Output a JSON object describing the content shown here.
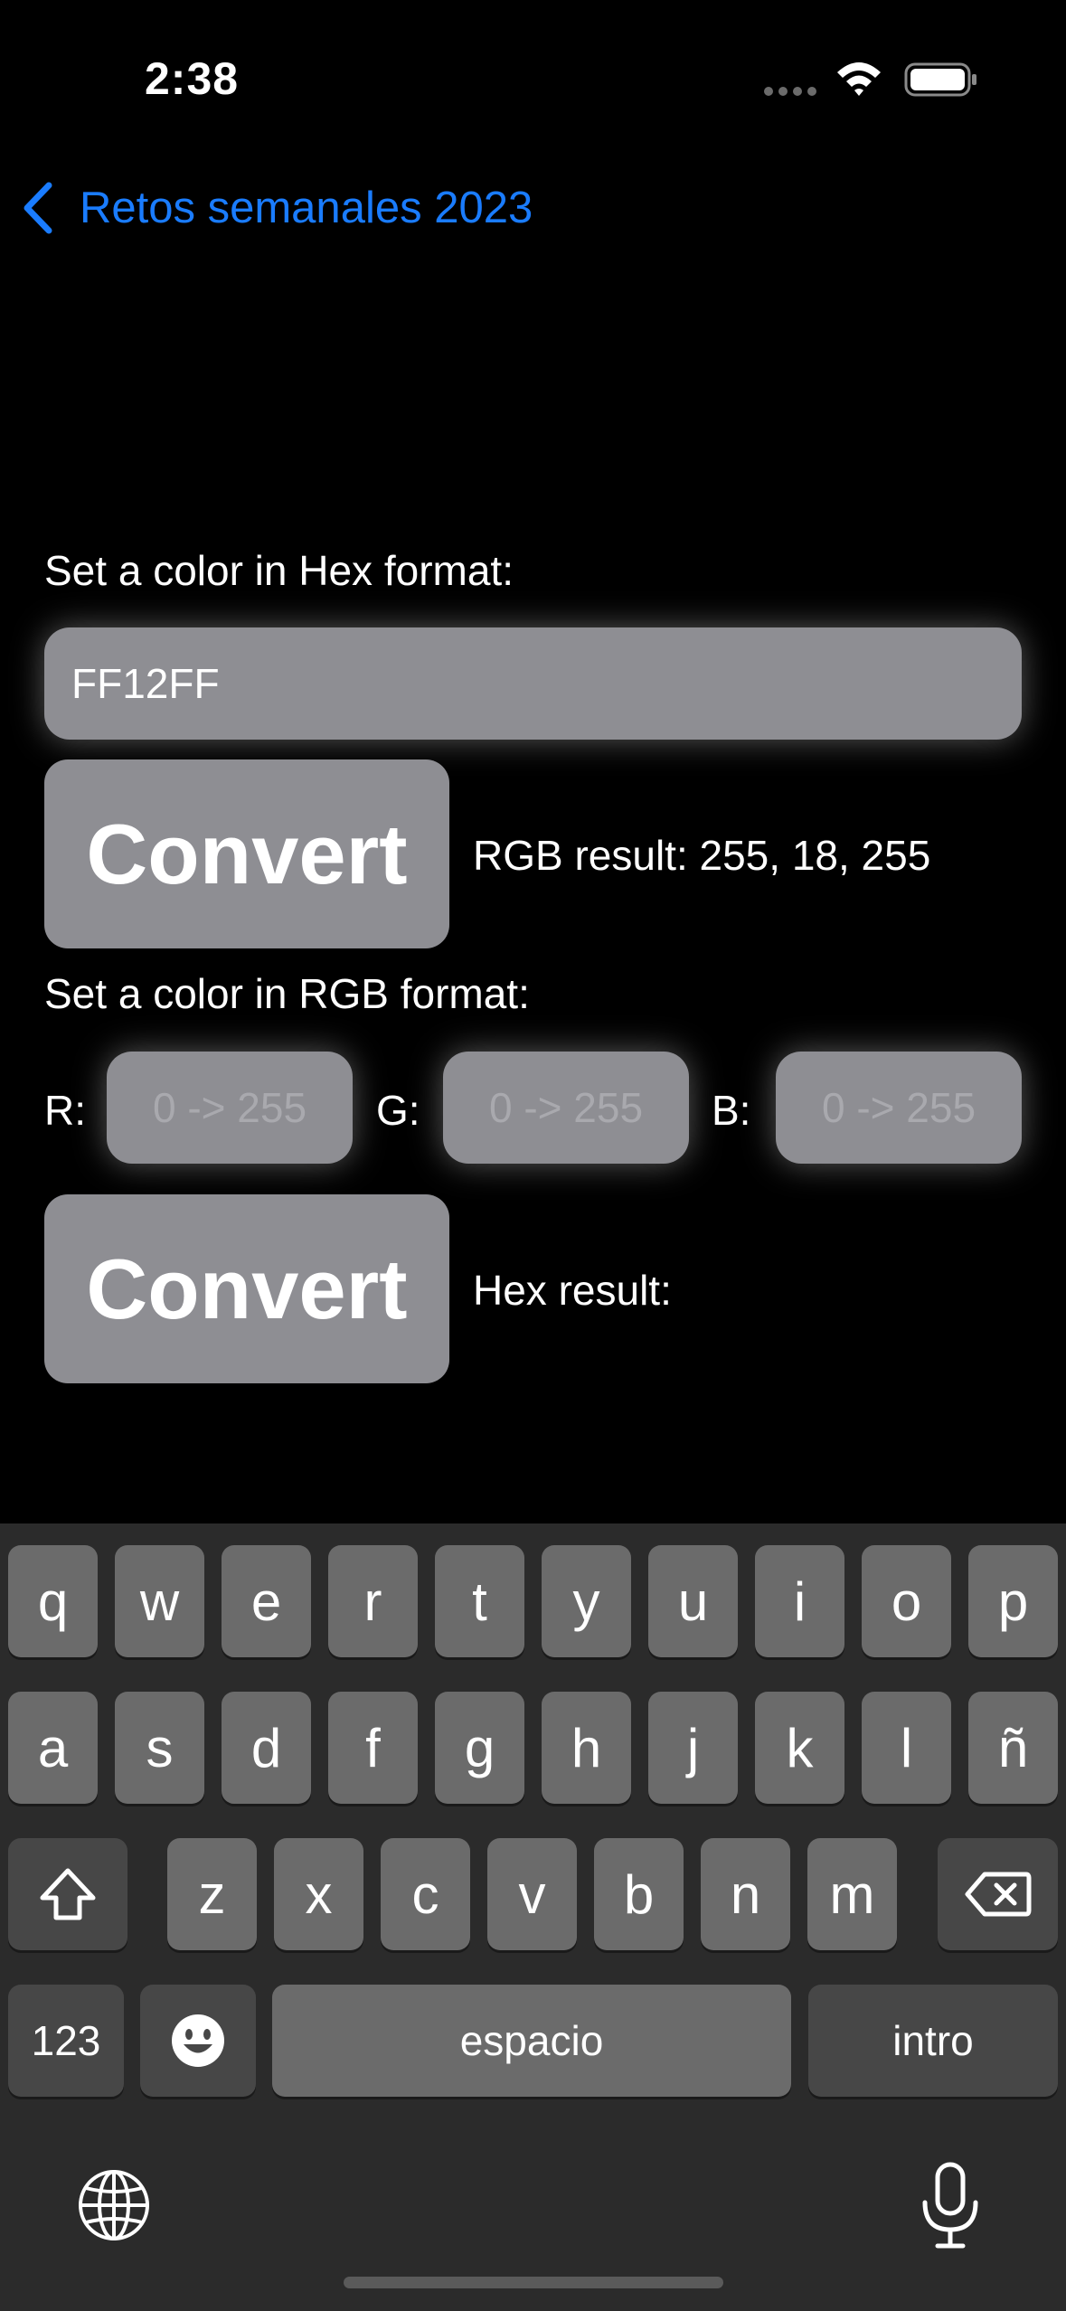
{
  "status_bar": {
    "time": "2:38"
  },
  "nav": {
    "back_label": "Retos semanales 2023"
  },
  "hex_section": {
    "label": "Set a color in Hex format:",
    "input_value": "FF12FF",
    "convert_label": "Convert",
    "result_text": "RGB result: 255, 18, 255"
  },
  "rgb_section": {
    "label": "Set a color in RGB format:",
    "r_label": "R:",
    "g_label": "G:",
    "b_label": "B:",
    "placeholder": "0 -> 255",
    "convert_label": "Convert",
    "result_text": "Hex result:"
  },
  "keyboard": {
    "row1": [
      "q",
      "w",
      "e",
      "r",
      "t",
      "y",
      "u",
      "i",
      "o",
      "p"
    ],
    "row2": [
      "a",
      "s",
      "d",
      "f",
      "g",
      "h",
      "j",
      "k",
      "l",
      "ñ"
    ],
    "row3": [
      "z",
      "x",
      "c",
      "v",
      "b",
      "n",
      "m"
    ],
    "numbers_label": "123",
    "space_label": "espacio",
    "return_label": "intro",
    "icons": [
      "shift-icon",
      "delete-icon",
      "emoji-icon",
      "globe-icon",
      "microphone-icon"
    ]
  },
  "colors": {
    "accent": "#1a7cff",
    "field": "#8e8e93",
    "background": "#000000"
  }
}
